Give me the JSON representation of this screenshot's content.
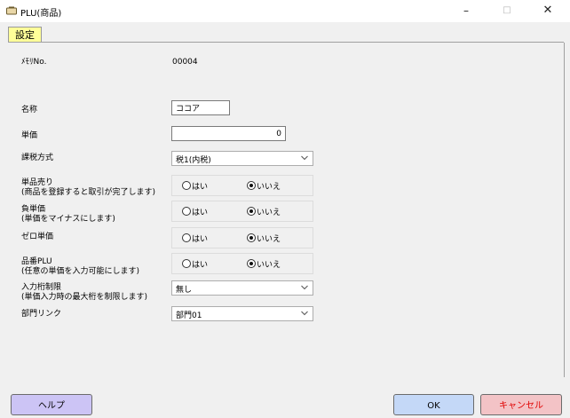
{
  "window": {
    "title": "PLU(商品)",
    "controls": {
      "minimize": "–",
      "maximize": "□",
      "close": "✕"
    },
    "icon": "app-logo-icon"
  },
  "tab": {
    "label": "設定"
  },
  "form": {
    "memory_no": {
      "label": "ﾒﾓﾘNo.",
      "value": "00004"
    },
    "name": {
      "label": "名称",
      "value": "ココア"
    },
    "unit_price": {
      "label": "単価",
      "value": "0"
    },
    "tax_method": {
      "label": "課税方式",
      "selected": "税1(内税)"
    },
    "single_sale": {
      "label_line1": "単品売り",
      "label_line2": "(商品を登録すると取引が完了します)",
      "options": [
        "○はい",
        "◉いいえ"
      ],
      "option_yes": "はい",
      "option_no": "いいえ",
      "selected": "いいえ"
    },
    "negative_price": {
      "label_line1": "負単価",
      "label_line2": "(単価をマイナスにします)",
      "option_yes": "はい",
      "option_no": "いいえ",
      "selected": "いいえ"
    },
    "zero_price": {
      "label": "ゼロ単価",
      "option_yes": "はい",
      "option_no": "いいえ",
      "selected": "いいえ"
    },
    "product_plu": {
      "label_line1": "品番PLU",
      "label_line2": "(任意の単価を入力可能にします)",
      "option_yes": "はい",
      "option_no": "いいえ",
      "selected": "いいえ"
    },
    "digit_limit": {
      "label_line1": "入力桁制限",
      "label_line2": "(単価入力時の最大桁を制限します)",
      "selected": "無し"
    },
    "department_link": {
      "label": "部門リンク",
      "selected": "部門01"
    }
  },
  "buttons": {
    "help": "ヘルプ",
    "ok": "OK",
    "cancel": "キャンセル"
  },
  "colors": {
    "tab_bg": "#ffff99",
    "help_bg": "#ccc4f5",
    "ok_bg": "#c4d8f7",
    "cancel_bg": "#f3c3c6",
    "cancel_text": "#e00000"
  }
}
